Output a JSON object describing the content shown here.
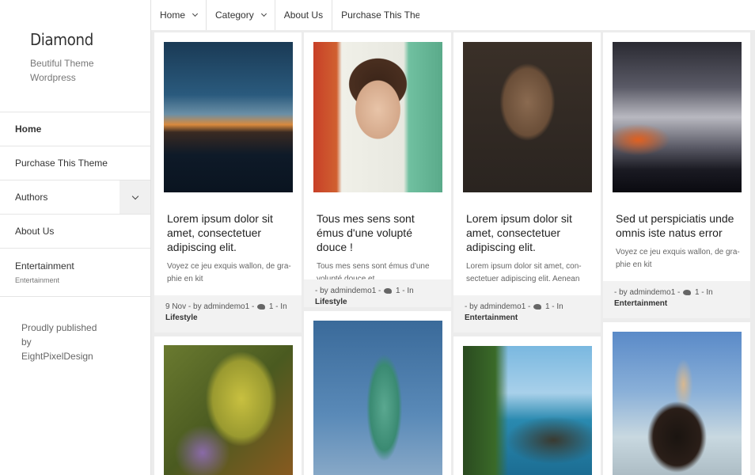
{
  "site": {
    "title": "Diamond",
    "tagline": "Beutiful Theme Wordpress",
    "footer": "Proudly published by EightPixelDesign"
  },
  "sidebar": {
    "items": [
      {
        "label": "Home"
      },
      {
        "label": "Purchase This Theme"
      },
      {
        "label": "Authors",
        "icon": "chevron-down-icon"
      },
      {
        "label": "About Us"
      },
      {
        "label": "Entertainment",
        "sub": "Entertainment"
      }
    ]
  },
  "topnav": {
    "items": [
      {
        "label": "Home",
        "icon": "chevron-down-icon"
      },
      {
        "label": "Category",
        "icon": "chevron-down-icon"
      },
      {
        "label": "About Us"
      },
      {
        "label": "Purchase This Theme"
      }
    ]
  },
  "posts": [
    {
      "title": "Lorem ipsum dolor sit amet, consectetuer adipiscing elit.",
      "excerpt": "Voyez ce jeu exquis wallon, de gra-phie en kit",
      "date": "9 Nov",
      "by": " - by admindemo1 - ",
      "comments": "1",
      "in": " - In",
      "category": "Lifestyle",
      "image": "night-coastal-city"
    },
    {
      "title": "Tous mes sens sont émus d'une volupté douce !",
      "excerpt": "Tous mes sens sont émus d'une volupté douce et",
      "by": "- by admindemo1 - ",
      "comments": "1",
      "in": " - In ",
      "category": "Lifestyle",
      "image": "young-boy-portrait"
    },
    {
      "title": "Lorem ipsum dolor sit amet, consectetuer adipiscing elit.",
      "excerpt": "Lorem ipsum dolor sit amet, con-sectetuer adipiscing elit. Aenean",
      "by": "- by admindemo1 - ",
      "comments": "1",
      "in": " - In",
      "category": "Entertainment",
      "image": "old-man-portrait"
    },
    {
      "title": "Sed ut perspiciatis unde omnis iste natus error",
      "excerpt": "Voyez ce jeu exquis wallon, de gra-phie en kit",
      "by": "- by admindemo1 - ",
      "comments": "1",
      "in": " - In",
      "category": "Entertainment",
      "image": "lightning-storm"
    },
    {
      "image": "gecko-closeup"
    },
    {
      "image": "statue-of-liberty"
    },
    {
      "image": "rocky-coastline"
    },
    {
      "image": "horse-rider-beach"
    }
  ],
  "colors": {
    "background": "#ececec",
    "card": "#ffffff",
    "meta_bg": "#f2f2f2",
    "text": "#333333"
  }
}
